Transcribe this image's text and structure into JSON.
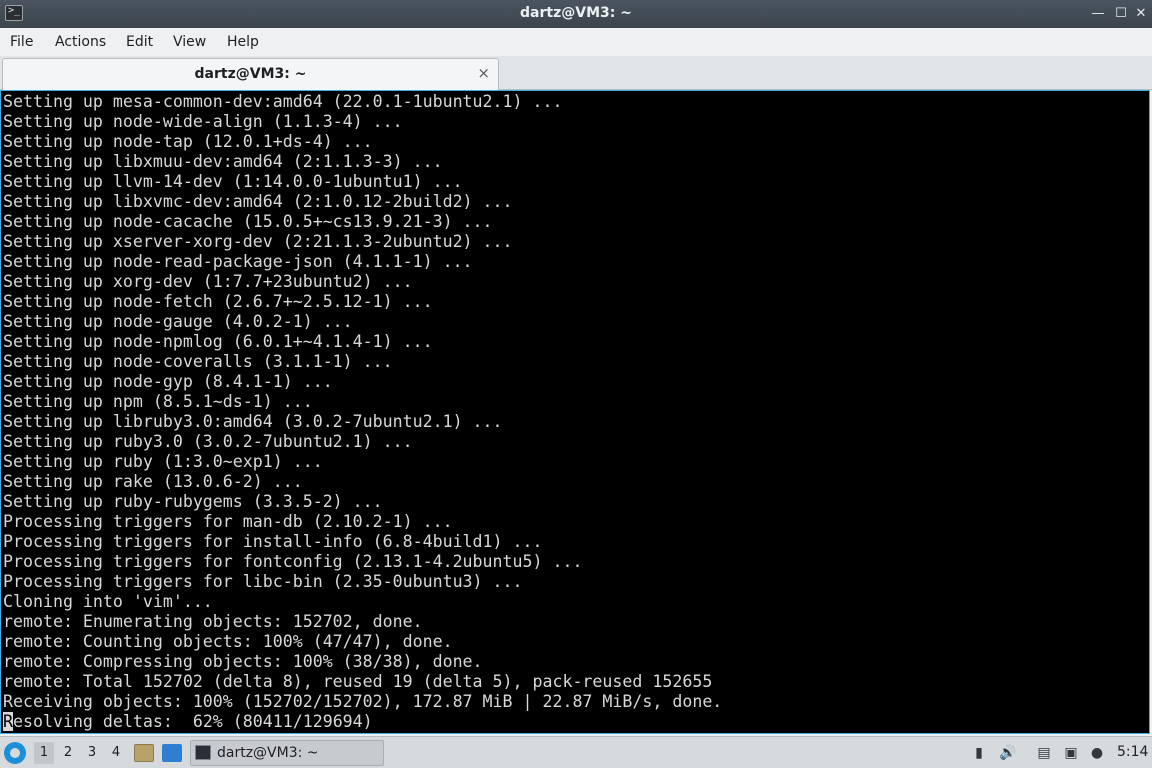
{
  "window": {
    "title": "dartz@VM3: ~",
    "controls": {
      "minimize": "—",
      "maximize": "☐",
      "close": "✕"
    },
    "title_icon": ">_"
  },
  "menubar": {
    "items": [
      "File",
      "Actions",
      "Edit",
      "View",
      "Help"
    ]
  },
  "tabs": [
    {
      "label": "dartz@VM3: ~",
      "close": "×"
    }
  ],
  "terminal": {
    "lines": [
      "Setting up mesa-common-dev:amd64 (22.0.1-1ubuntu2.1) ...",
      "Setting up node-wide-align (1.1.3-4) ...",
      "Setting up node-tap (12.0.1+ds-4) ...",
      "Setting up libxmuu-dev:amd64 (2:1.1.3-3) ...",
      "Setting up llvm-14-dev (1:14.0.0-1ubuntu1) ...",
      "Setting up libxvmc-dev:amd64 (2:1.0.12-2build2) ...",
      "Setting up node-cacache (15.0.5+~cs13.9.21-3) ...",
      "Setting up xserver-xorg-dev (2:21.1.3-2ubuntu2) ...",
      "Setting up node-read-package-json (4.1.1-1) ...",
      "Setting up xorg-dev (1:7.7+23ubuntu2) ...",
      "Setting up node-fetch (2.6.7+~2.5.12-1) ...",
      "Setting up node-gauge (4.0.2-1) ...",
      "Setting up node-npmlog (6.0.1+~4.1.4-1) ...",
      "Setting up node-coveralls (3.1.1-1) ...",
      "Setting up node-gyp (8.4.1-1) ...",
      "Setting up npm (8.5.1~ds-1) ...",
      "Setting up libruby3.0:amd64 (3.0.2-7ubuntu2.1) ...",
      "Setting up ruby3.0 (3.0.2-7ubuntu2.1) ...",
      "Setting up ruby (1:3.0~exp1) ...",
      "Setting up rake (13.0.6-2) ...",
      "Setting up ruby-rubygems (3.3.5-2) ...",
      "Processing triggers for man-db (2.10.2-1) ...",
      "Processing triggers for install-info (6.8-4build1) ...",
      "Processing triggers for fontconfig (2.13.1-4.2ubuntu5) ...",
      "Processing triggers for libc-bin (2.35-0ubuntu3) ...",
      "Cloning into 'vim'...",
      "remote: Enumerating objects: 152702, done.",
      "remote: Counting objects: 100% (47/47), done.",
      "remote: Compressing objects: 100% (38/38), done.",
      "remote: Total 152702 (delta 8), reused 19 (delta 5), pack-reused 152655",
      "Receiving objects: 100% (152702/152702), 172.87 MiB | 22.87 MiB/s, done."
    ],
    "last_line_cursor_char": "R",
    "last_line_rest": "esolving deltas:  62% (80411/129694)"
  },
  "taskbar": {
    "workspaces": [
      "1",
      "2",
      "3",
      "4"
    ],
    "active_workspace": "1",
    "task_label": "dartz@VM3: ~",
    "clock": "5:14",
    "icons": {
      "start": "start-menu-icon",
      "file_manager": "file-manager-icon",
      "desktop": "show-desktop-icon",
      "terminal": "terminal-icon",
      "tray": [
        "removable-media-icon",
        "volume-icon",
        "clipboard-icon",
        "network-icon",
        "notification-icon"
      ]
    },
    "colors": {
      "accent": "#3daee9",
      "start": "#1d8fd6"
    }
  }
}
